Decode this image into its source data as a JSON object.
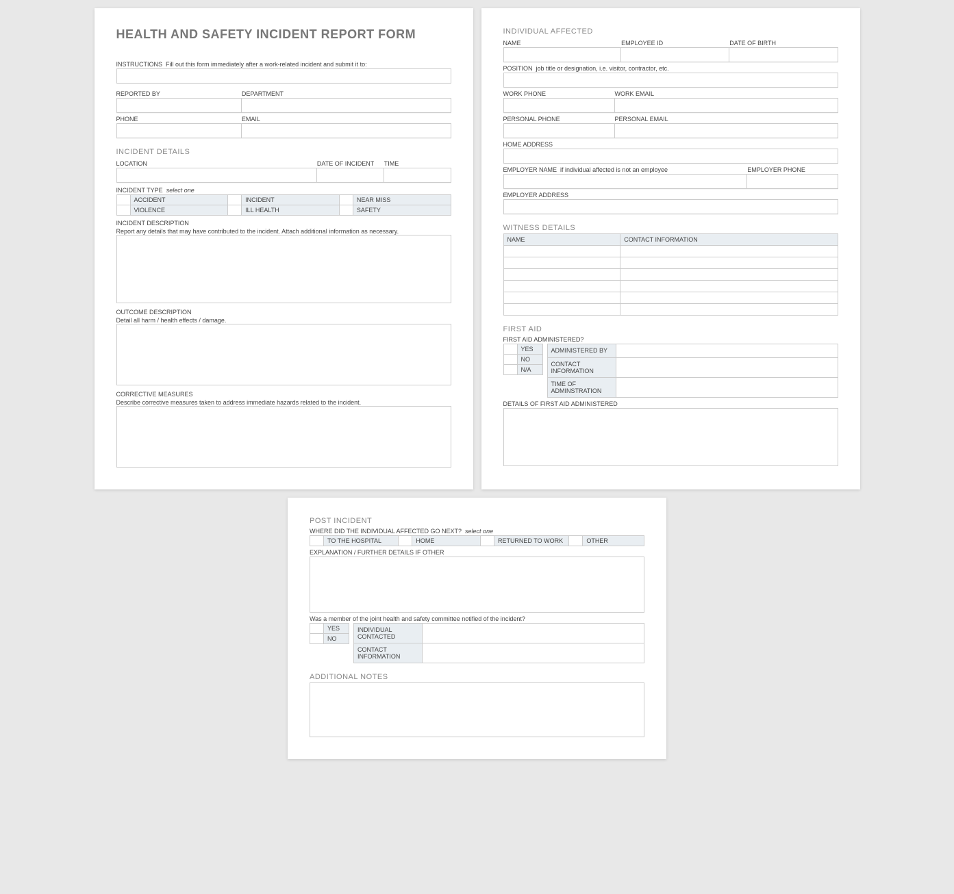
{
  "title": "HEALTH AND SAFETY INCIDENT REPORT FORM",
  "instructions": {
    "label": "INSTRUCTIONS",
    "hint": "Fill out this form immediately after a work-related incident and submit it to:"
  },
  "reporter": {
    "reported_by": "REPORTED BY",
    "department": "DEPARTMENT",
    "phone": "PHONE",
    "email": "EMAIL"
  },
  "incident": {
    "heading": "INCIDENT DETAILS",
    "location": "LOCATION",
    "date": "DATE OF INCIDENT",
    "time": "TIME",
    "type_label": "INCIDENT TYPE",
    "type_hint": "select one",
    "types_row1": [
      "ACCIDENT",
      "INCIDENT",
      "NEAR MISS"
    ],
    "types_row2": [
      "VIOLENCE",
      "ILL HEALTH",
      "SAFETY"
    ],
    "desc_label": "INCIDENT DESCRIPTION",
    "desc_hint": "Report any details that may have contributed to the incident.  Attach additional information as necessary.",
    "outcome_label": "OUTCOME DESCRIPTION",
    "outcome_hint": "Detail all harm / health effects / damage.",
    "corrective_label": "CORRECTIVE MEASURES",
    "corrective_hint": "Describe corrective measures taken to address immediate hazards related to the incident."
  },
  "individual": {
    "heading": "INDIVIDUAL AFFECTED",
    "name": "NAME",
    "employee_id": "EMPLOYEE ID",
    "dob": "DATE OF BIRTH",
    "position_label": "POSITION",
    "position_hint": "job title or designation, i.e. visitor, contractor, etc.",
    "work_phone": "WORK PHONE",
    "work_email": "WORK EMAIL",
    "personal_phone": "PERSONAL PHONE",
    "personal_email": "PERSONAL EMAIL",
    "home_address": "HOME ADDRESS",
    "employer_name_label": "EMPLOYER NAME",
    "employer_name_hint": "if individual affected is not an employee",
    "employer_phone": "EMPLOYER PHONE",
    "employer_address": "EMPLOYER ADDRESS"
  },
  "witness": {
    "heading": "WITNESS DETAILS",
    "col_name": "NAME",
    "col_contact": "CONTACT INFORMATION",
    "rows": 6
  },
  "firstaid": {
    "heading": "FIRST AID",
    "question": "FIRST AID ADMINISTERED?",
    "options": [
      "YES",
      "NO",
      "N/A"
    ],
    "fields": [
      "ADMINISTERED BY",
      "CONTACT INFORMATION",
      "TIME OF ADMINSTRATION"
    ],
    "details_label": "DETAILS OF FIRST AID ADMINISTERED"
  },
  "post": {
    "heading": "POST INCIDENT",
    "where_label": "WHERE DID THE INDIVIDUAL AFFECTED GO NEXT?",
    "where_hint": "select one",
    "where_options": [
      "TO THE HOSPITAL",
      "HOME",
      "RETURNED TO WORK",
      "OTHER"
    ],
    "explanation_label": "EXPLANATION / FURTHER DETAILS IF OTHER",
    "committee_q": "Was a member of the joint health and safety committee notified of the incident?",
    "committee_options": [
      "YES",
      "NO"
    ],
    "committee_fields": [
      "INDIVIDUAL CONTACTED",
      "CONTACT INFORMATION"
    ]
  },
  "notes": {
    "heading": "ADDITIONAL NOTES"
  }
}
